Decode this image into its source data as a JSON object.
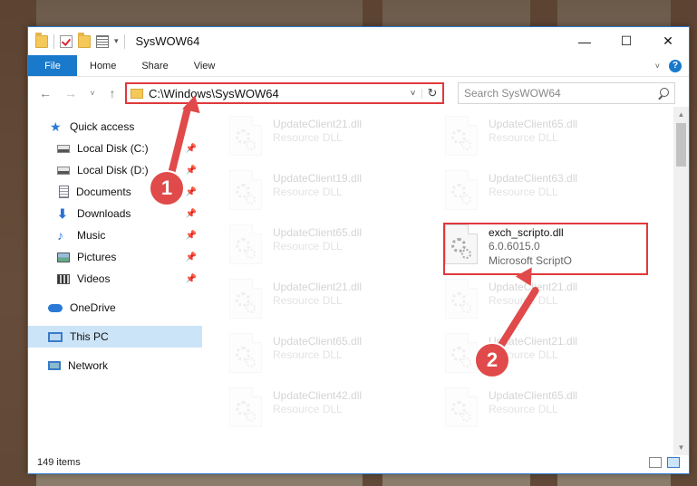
{
  "window": {
    "title": "SysWOW64",
    "minimize": "—",
    "maximize": "☐",
    "close": "✕"
  },
  "ribbon": {
    "tabs": [
      "File",
      "Home",
      "Share",
      "View"
    ]
  },
  "address": {
    "path": "C:\\Windows\\SysWOW64",
    "search_placeholder": "Search SysWOW64"
  },
  "nav": {
    "items": [
      {
        "label": "Quick access",
        "icon": "star-icon"
      },
      {
        "label": "Local Disk (C:)",
        "icon": "drive-icon",
        "pinned": true
      },
      {
        "label": "Local Disk (D:)",
        "icon": "drive-icon",
        "pinned": true
      },
      {
        "label": "Documents",
        "icon": "documents-icon",
        "pinned": true
      },
      {
        "label": "Downloads",
        "icon": "download-icon",
        "pinned": true
      },
      {
        "label": "Music",
        "icon": "music-icon",
        "pinned": true
      },
      {
        "label": "Pictures",
        "icon": "pictures-icon",
        "pinned": true
      },
      {
        "label": "Videos",
        "icon": "videos-icon",
        "pinned": true
      },
      {
        "label": "OneDrive",
        "icon": "cloud-icon"
      },
      {
        "label": "This PC",
        "icon": "computer-icon",
        "selected": true
      },
      {
        "label": "Network",
        "icon": "network-icon"
      }
    ]
  },
  "files": {
    "left": [
      {
        "name": "UpdateClient21.dll",
        "sub": "Resource DLL"
      },
      {
        "name": "UpdateClient19.dll",
        "sub": "Resource DLL"
      },
      {
        "name": "UpdateClient65.dll",
        "sub": "Resource DLL"
      },
      {
        "name": "UpdateClient21.dll",
        "sub": "Resource DLL"
      },
      {
        "name": "UpdateClient65.dll",
        "sub": "Resource DLL"
      },
      {
        "name": "UpdateClient42.dll",
        "sub": "Resource DLL"
      }
    ],
    "right": [
      {
        "name": "UpdateClient65.dll",
        "sub": "Resource DLL"
      },
      {
        "name": "UpdateClient63.dll",
        "sub": "Resource DLL"
      },
      {
        "name": "exch_scripto.dll",
        "sub": "6.0.6015.0",
        "sub2": "Microsoft ScriptO",
        "highlight": true
      },
      {
        "name": "UpdateClient21.dll",
        "sub": "Resource DLL"
      },
      {
        "name": "UpdateClient21.dll",
        "sub": "Resource DLL"
      },
      {
        "name": "UpdateClient65.dll",
        "sub": "Resource DLL"
      }
    ]
  },
  "status": {
    "count": "149 items"
  },
  "callouts": {
    "one": "1",
    "two": "2"
  },
  "colors": {
    "accent": "#1979ca",
    "highlight": "#e0393c",
    "selection": "#cce4f7"
  }
}
